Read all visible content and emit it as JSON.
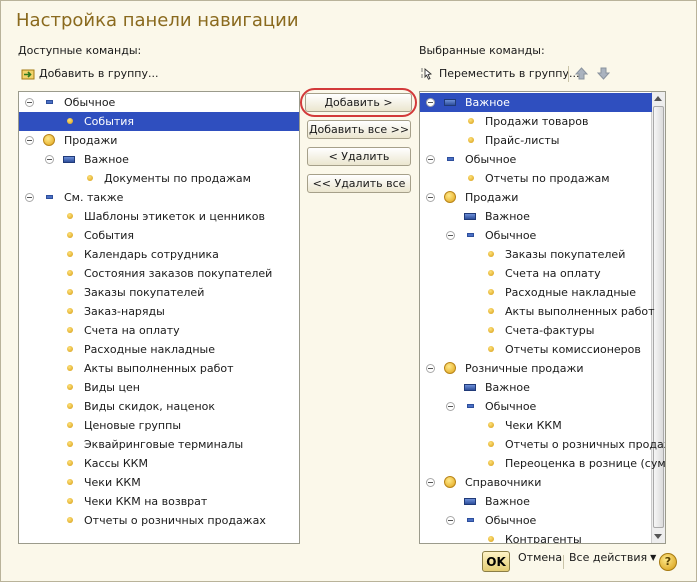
{
  "title": "Настройка панели навигации",
  "left": {
    "label": "Доступные команды:",
    "add_group": "Добавить в группу...",
    "items": [
      {
        "text": "Обычное",
        "level": 0,
        "icon": "dash",
        "exp": true
      },
      {
        "text": "События",
        "level": 1,
        "icon": "dot",
        "sel": true
      },
      {
        "text": "Продажи",
        "level": 0,
        "icon": "grp",
        "exp": true
      },
      {
        "text": "Важное",
        "level": 1,
        "icon": "pnl",
        "exp": true
      },
      {
        "text": "Документы по продажам",
        "level": 2,
        "icon": "dot"
      },
      {
        "text": "См. также",
        "level": 0,
        "icon": "dash",
        "exp": true
      },
      {
        "text": "Шаблоны этикеток и ценников",
        "level": 1,
        "icon": "dot"
      },
      {
        "text": "События",
        "level": 1,
        "icon": "dot"
      },
      {
        "text": "Календарь сотрудника",
        "level": 1,
        "icon": "dot"
      },
      {
        "text": "Состояния заказов покупателей",
        "level": 1,
        "icon": "dot"
      },
      {
        "text": "Заказы покупателей",
        "level": 1,
        "icon": "dot"
      },
      {
        "text": "Заказ-наряды",
        "level": 1,
        "icon": "dot"
      },
      {
        "text": "Счета на оплату",
        "level": 1,
        "icon": "dot"
      },
      {
        "text": "Расходные накладные",
        "level": 1,
        "icon": "dot"
      },
      {
        "text": "Акты выполненных работ",
        "level": 1,
        "icon": "dot"
      },
      {
        "text": "Виды цен",
        "level": 1,
        "icon": "dot"
      },
      {
        "text": "Виды скидок, наценок",
        "level": 1,
        "icon": "dot"
      },
      {
        "text": "Ценовые группы",
        "level": 1,
        "icon": "dot"
      },
      {
        "text": "Эквайринговые терминалы",
        "level": 1,
        "icon": "dot"
      },
      {
        "text": "Кассы ККМ",
        "level": 1,
        "icon": "dot"
      },
      {
        "text": "Чеки ККМ",
        "level": 1,
        "icon": "dot"
      },
      {
        "text": "Чеки ККМ на возврат",
        "level": 1,
        "icon": "dot"
      },
      {
        "text": "Отчеты о розничных продажах",
        "level": 1,
        "icon": "dot"
      }
    ]
  },
  "buttons": {
    "add": "Добавить >",
    "add_all": "Добавить все >>",
    "remove": "< Удалить",
    "remove_all": "<< Удалить все"
  },
  "right": {
    "label": "Выбранные команды:",
    "move_group": "Переместить в группу...",
    "items": [
      {
        "text": "Важное",
        "level": 0,
        "icon": "pnl",
        "exp": true,
        "sel": true
      },
      {
        "text": "Продажи товаров",
        "level": 1,
        "icon": "dot"
      },
      {
        "text": "Прайс-листы",
        "level": 1,
        "icon": "dot"
      },
      {
        "text": "Обычное",
        "level": 0,
        "icon": "dash",
        "exp": true
      },
      {
        "text": "Отчеты по продажам",
        "level": 1,
        "icon": "dot"
      },
      {
        "text": "Продажи",
        "level": 0,
        "icon": "grp",
        "exp": true
      },
      {
        "text": "Важное",
        "level": 1,
        "icon": "pnl"
      },
      {
        "text": "Обычное",
        "level": 1,
        "icon": "dash",
        "exp": true
      },
      {
        "text": "Заказы покупателей",
        "level": 2,
        "icon": "dot"
      },
      {
        "text": "Счета на оплату",
        "level": 2,
        "icon": "dot"
      },
      {
        "text": "Расходные накладные",
        "level": 2,
        "icon": "dot"
      },
      {
        "text": "Акты выполненных работ",
        "level": 2,
        "icon": "dot"
      },
      {
        "text": "Счета-фактуры",
        "level": 2,
        "icon": "dot"
      },
      {
        "text": "Отчеты комиссионеров",
        "level": 2,
        "icon": "dot"
      },
      {
        "text": "Розничные продажи",
        "level": 0,
        "icon": "grp",
        "exp": true
      },
      {
        "text": "Важное",
        "level": 1,
        "icon": "pnl"
      },
      {
        "text": "Обычное",
        "level": 1,
        "icon": "dash",
        "exp": true
      },
      {
        "text": "Чеки ККМ",
        "level": 2,
        "icon": "dot"
      },
      {
        "text": "Отчеты о розничных продажах",
        "level": 2,
        "icon": "dot"
      },
      {
        "text": "Переоценка в рознице (сум...",
        "level": 2,
        "icon": "dot"
      },
      {
        "text": "Справочники",
        "level": 0,
        "icon": "grp",
        "exp": true
      },
      {
        "text": "Важное",
        "level": 1,
        "icon": "pnl"
      },
      {
        "text": "Обычное",
        "level": 1,
        "icon": "dash",
        "exp": true
      },
      {
        "text": "Контрагенты",
        "level": 2,
        "icon": "dot"
      }
    ]
  },
  "footer": {
    "ok": "OK",
    "cancel": "Отмена",
    "all_actions": "Все действия",
    "help": "?"
  }
}
